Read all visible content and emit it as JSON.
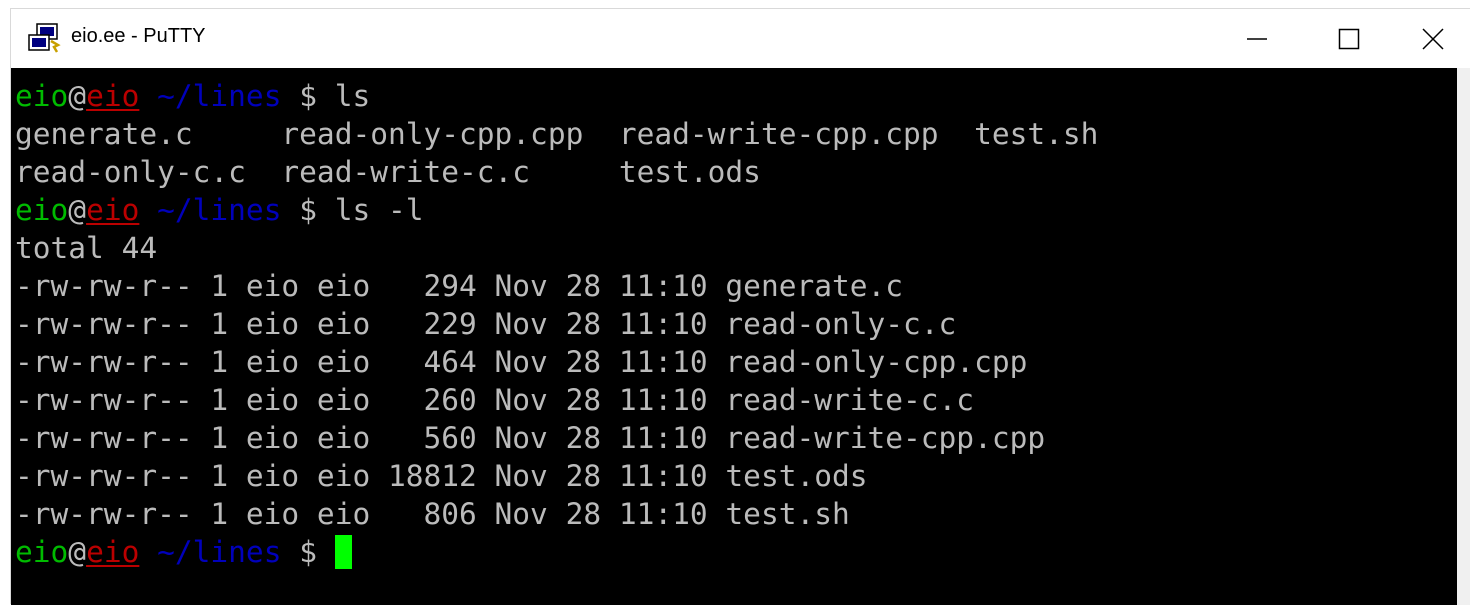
{
  "window": {
    "title": "eio.ee - PuTTY",
    "icon": "putty-icon",
    "controls": [
      "minimize-icon",
      "maximize-icon",
      "close-icon"
    ]
  },
  "prompt": {
    "user": "eio",
    "at": "@",
    "host": "eio",
    "path": "~/lines",
    "symbol": "$",
    "user_color": "#00bb00",
    "host_color": "#bb0000",
    "path_color": "#0000bb"
  },
  "terminal": {
    "background": "#000000",
    "text_color": "#bbbbbb",
    "cursor_color": "#00ff00",
    "commands": [
      "ls",
      "ls -l"
    ],
    "ls_output": [
      "generate.c     read-only-cpp.cpp  read-write-cpp.cpp  test.sh",
      "read-only-c.c  read-write-c.c     test.ods"
    ],
    "ls_l_total": "total 44",
    "ls_l_rows": [
      "-rw-rw-r-- 1 eio eio   294 Nov 28 11:10 generate.c",
      "-rw-rw-r-- 1 eio eio   229 Nov 28 11:10 read-only-c.c",
      "-rw-rw-r-- 1 eio eio   464 Nov 28 11:10 read-only-cpp.cpp",
      "-rw-rw-r-- 1 eio eio   260 Nov 28 11:10 read-write-c.c",
      "-rw-rw-r-- 1 eio eio   560 Nov 28 11:10 read-write-cpp.cpp",
      "-rw-rw-r-- 1 eio eio 18812 Nov 28 11:10 test.ods",
      "-rw-rw-r-- 1 eio eio   806 Nov 28 11:10 test.sh"
    ]
  }
}
